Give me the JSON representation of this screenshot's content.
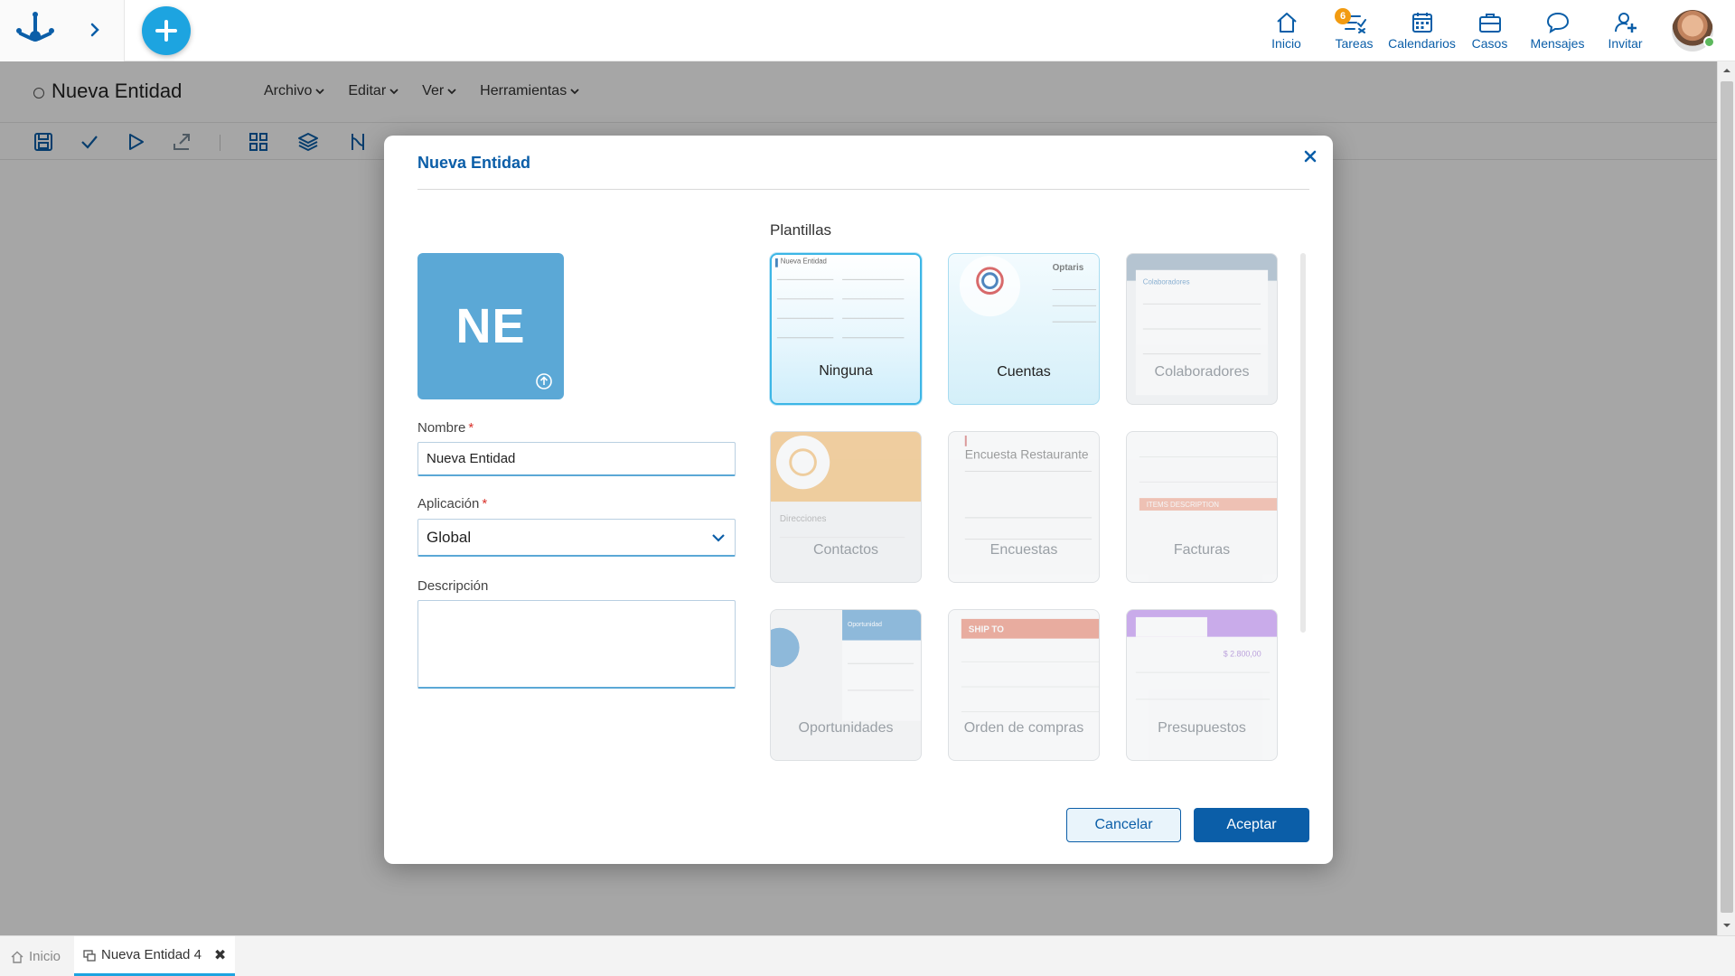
{
  "topnav": {
    "items": [
      {
        "label": "Inicio",
        "icon": "home-icon"
      },
      {
        "label": "Tareas",
        "icon": "tasks-icon",
        "badge": "6"
      },
      {
        "label": "Calendarios",
        "icon": "calendar-icon"
      },
      {
        "label": "Casos",
        "icon": "briefcase-icon"
      },
      {
        "label": "Mensajes",
        "icon": "chat-icon"
      },
      {
        "label": "Invitar",
        "icon": "add-user-icon"
      }
    ]
  },
  "editor": {
    "title": "Nueva Entidad",
    "menus": [
      "Archivo",
      "Editar",
      "Ver",
      "Herramientas"
    ]
  },
  "modal": {
    "title": "Nueva Entidad",
    "avatar_initials": "NE",
    "name_label": "Nombre",
    "name_value": "Nueva Entidad",
    "app_label": "Aplicación",
    "app_value": "Global",
    "description_label": "Descripción",
    "description_value": "",
    "templates_title": "Plantillas",
    "templates": [
      {
        "label": "Ninguna",
        "preview_text": "Nueva Entidad"
      },
      {
        "label": "Cuentas",
        "preview_text": "Optaris"
      },
      {
        "label": "Colaboradores",
        "preview_text": "Colaboradores"
      },
      {
        "label": "Contactos",
        "preview_text": "Direcciones"
      },
      {
        "label": "Encuestas",
        "preview_text": "Encuesta Restaurante"
      },
      {
        "label": "Facturas",
        "preview_text": "ITEMS    DESCRIPTION"
      },
      {
        "label": "Oportunidades",
        "preview_text": "Oportunidad"
      },
      {
        "label": "Orden de compras",
        "preview_text": "SHIP TO"
      },
      {
        "label": "Presupuestos",
        "preview_text": "$ 2.800,00"
      }
    ],
    "cancel_label": "Cancelar",
    "accept_label": "Aceptar"
  },
  "bottom_tabs": {
    "home_label": "Inicio",
    "active_label": "Nueva Entidad 4"
  },
  "colors": {
    "brand_blue": "#0b5ea8",
    "accent_cyan": "#1da4e0",
    "avatar_blue": "#5ba8d6",
    "badge_orange": "#f29b11"
  }
}
